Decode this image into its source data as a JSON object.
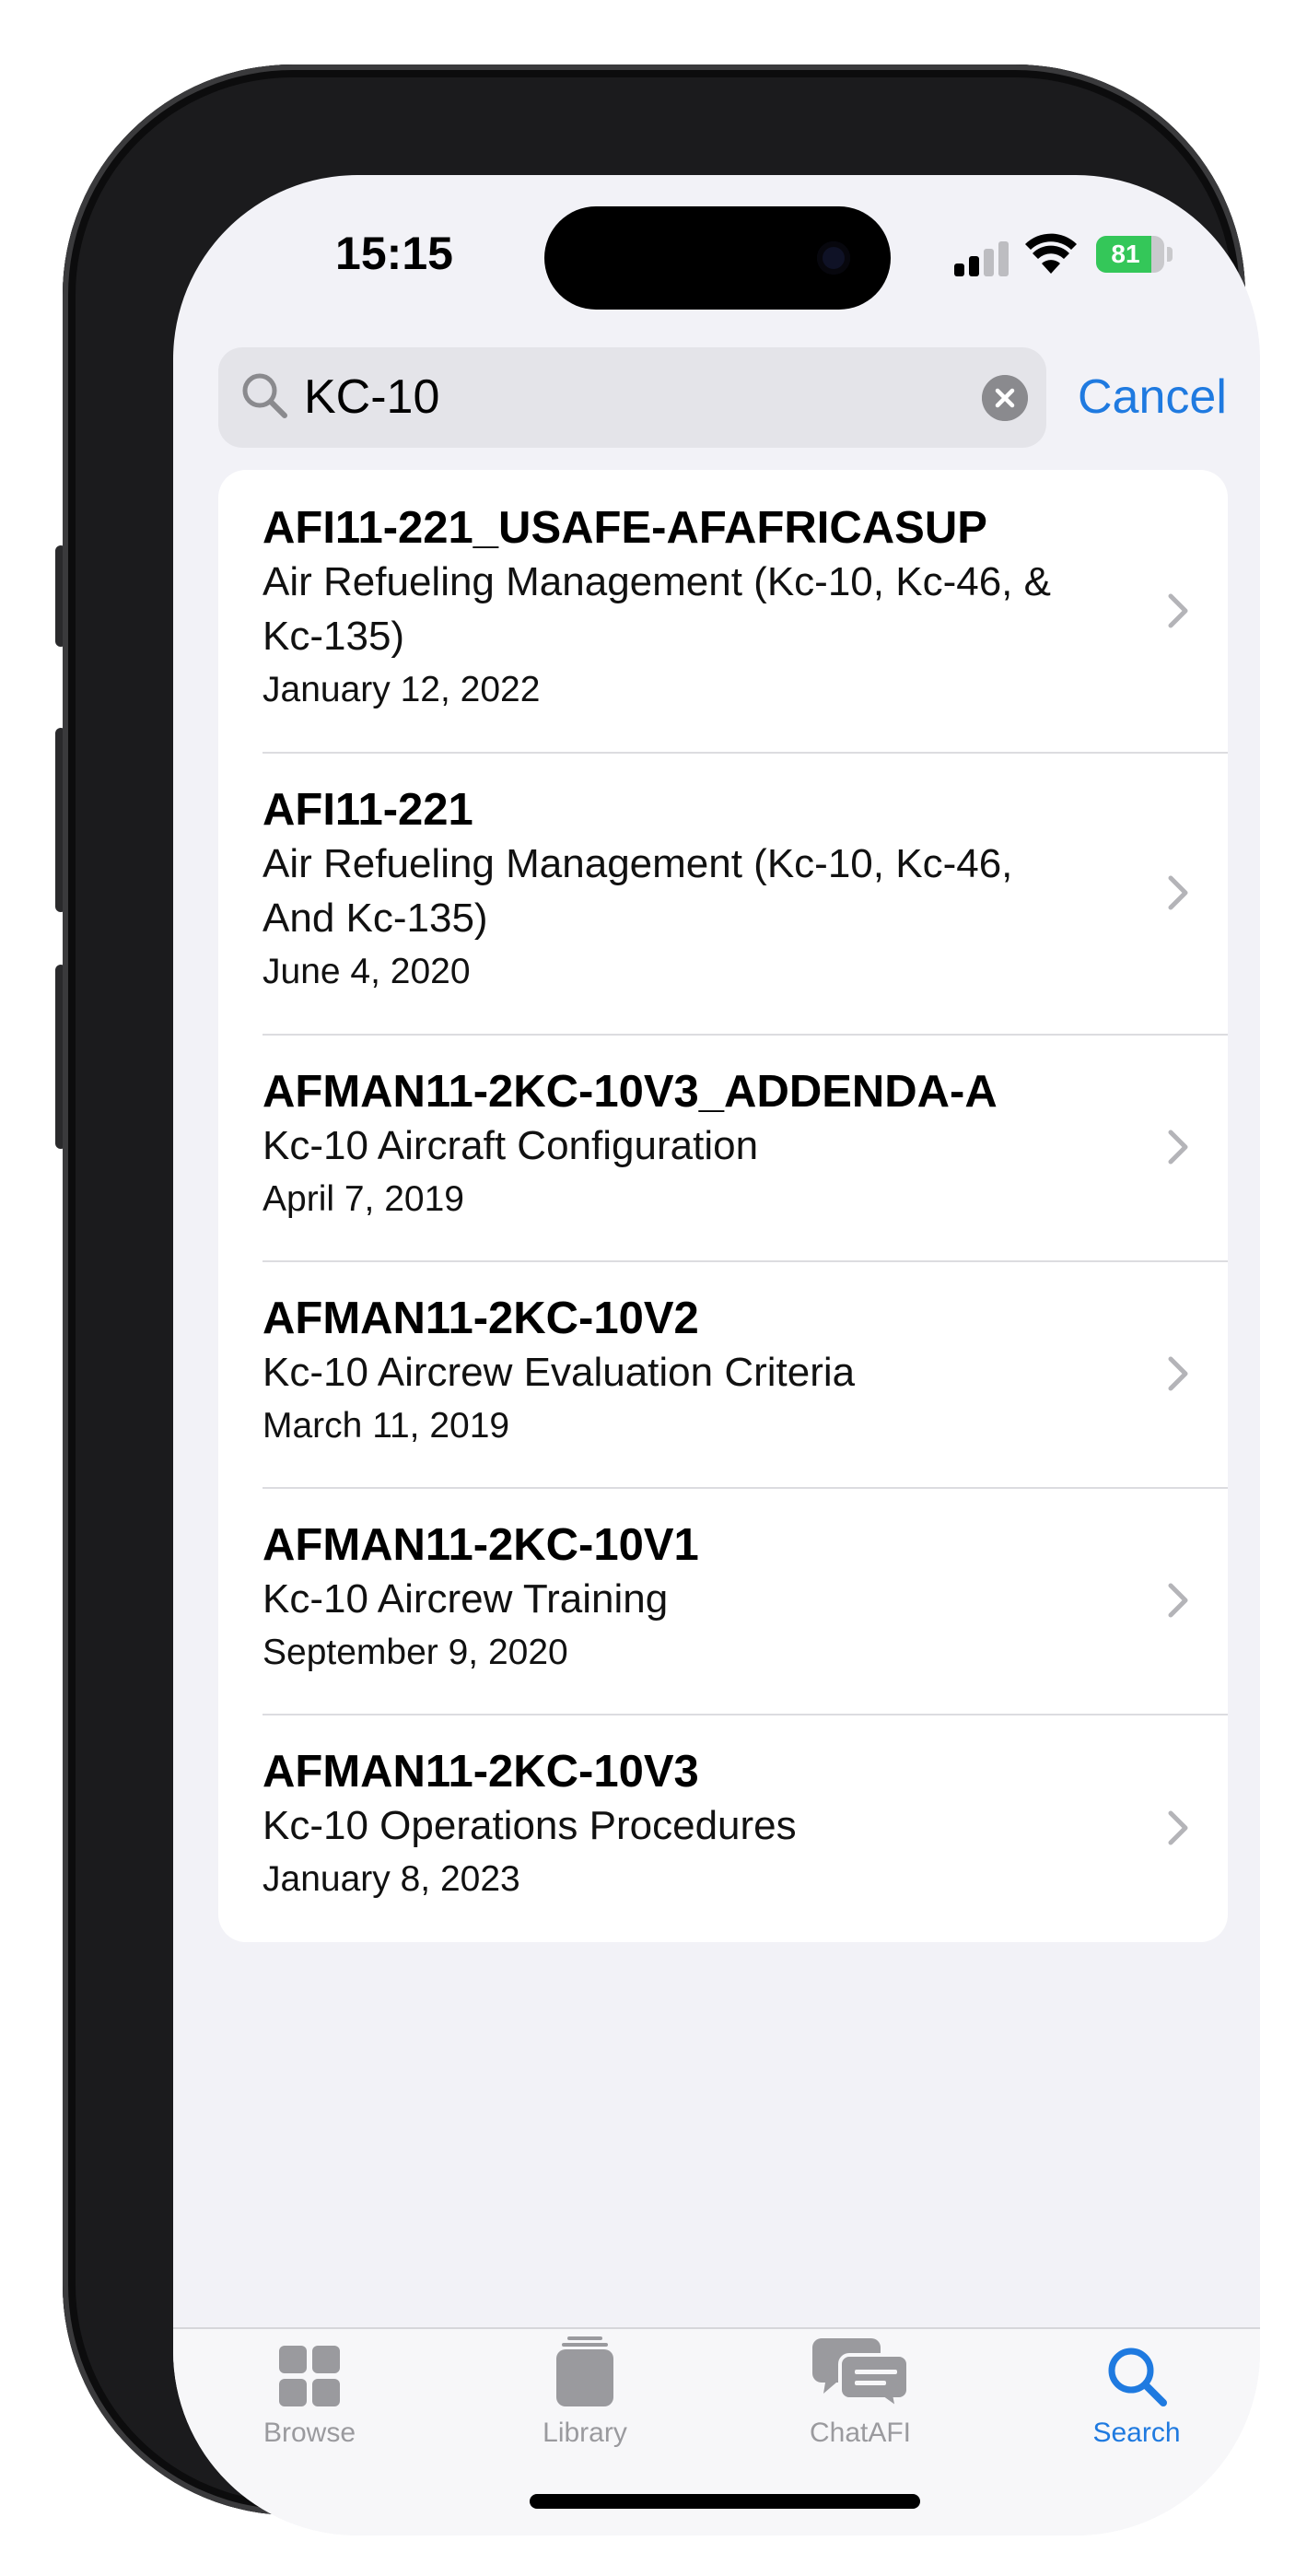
{
  "status_bar": {
    "time": "15:15",
    "battery_percent": 81
  },
  "search": {
    "query": "KC-10",
    "cancel_label": "Cancel"
  },
  "results": [
    {
      "title": "AFI11-221_USAFE-AFAFRICASUP",
      "subtitle_line1": "Air Refueling Management (Kc-10, Kc-46, &",
      "subtitle_line2": "Kc-135)",
      "date": "January 12, 2022"
    },
    {
      "title": "AFI11-221",
      "subtitle_line1": "Air Refueling Management (Kc-10, Kc-46,",
      "subtitle_line2": "And Kc-135)",
      "date": "June 4, 2020"
    },
    {
      "title": "AFMAN11-2KC-10V3_ADDENDA-A",
      "subtitle_line1": "Kc-10 Aircraft Configuration",
      "date": "April 7, 2019"
    },
    {
      "title": "AFMAN11-2KC-10V2",
      "subtitle_line1": "Kc-10 Aircrew Evaluation Criteria",
      "date": "March 11, 2019"
    },
    {
      "title": "AFMAN11-2KC-10V1",
      "subtitle_line1": "Kc-10 Aircrew Training",
      "date": "September 9, 2020"
    },
    {
      "title": "AFMAN11-2KC-10V3",
      "subtitle_line1": "Kc-10 Operations Procedures",
      "date": "January 8, 2023"
    }
  ],
  "tabbar": {
    "tabs": [
      {
        "label": "Browse",
        "icon": "grid-icon",
        "active": false
      },
      {
        "label": "Library",
        "icon": "library-icon",
        "active": false
      },
      {
        "label": "ChatAFI",
        "icon": "chat-bubbles-icon",
        "active": false
      },
      {
        "label": "Search",
        "icon": "search-icon",
        "active": true
      }
    ]
  },
  "colors": {
    "accent": "#1f7ae0",
    "battery": "#34c759",
    "background": "#f2f2f7"
  }
}
